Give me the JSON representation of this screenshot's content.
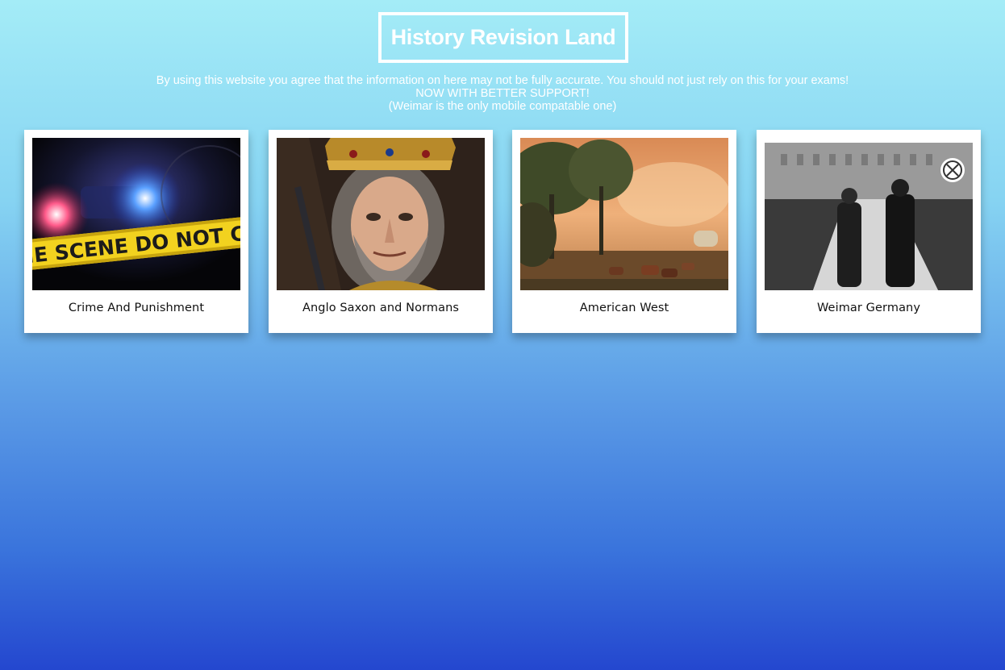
{
  "header": {
    "title": "History Revision Land"
  },
  "notice": {
    "line1": "By using this website you agree that the information on here may not be fully accurate. You should not just rely on this for your exams!",
    "line2": "NOW WITH BETTER SUPPORT!",
    "line3": "(Weimar is the only mobile compatable one)"
  },
  "cards": [
    {
      "label": "Crime And Punishment",
      "image_text": "IE SCENE DO NOT CROS"
    },
    {
      "label": "Anglo Saxon and Normans"
    },
    {
      "label": "American West"
    },
    {
      "label": "Weimar Germany"
    }
  ],
  "colors": {
    "accent": "#ffffff",
    "background_top": "#a4ecf7",
    "background_bottom": "#2447cf"
  }
}
